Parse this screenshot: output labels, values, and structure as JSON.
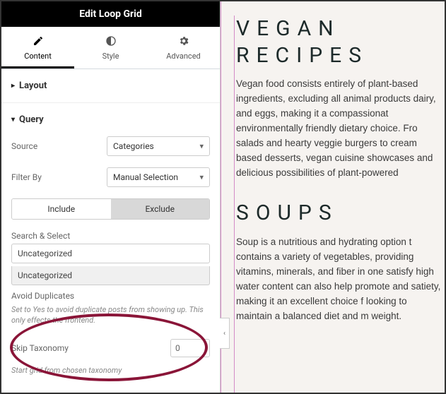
{
  "header": {
    "title": "Edit Loop Grid"
  },
  "tabs": {
    "content": "Content",
    "style": "Style",
    "advanced": "Advanced"
  },
  "sections": {
    "layout": "Layout",
    "query": "Query"
  },
  "query": {
    "source_label": "Source",
    "source_value": "Categories",
    "filter_label": "Filter By",
    "filter_value": "Manual Selection",
    "include_label": "Include",
    "exclude_label": "Exclude",
    "search_label": "Search & Select",
    "search_value": "Uncategorized",
    "dropdown_option": "Uncategorized",
    "avoid_label": "Avoid Duplicates",
    "avoid_help": "Set to Yes to avoid duplicate posts from showing up. This only effects the frontend.",
    "skip_label": "Skip Taxonomy",
    "skip_value": "0",
    "skip_help": "Start grid from chosen taxonomy"
  },
  "preview": {
    "h1a": "VEGAN",
    "h1b": "RECIPES",
    "p1": "Vegan food consists entirely of plant-based ingredients, excluding all animal products dairy, and eggs, making it a compassionat environmentally friendly dietary choice. Fro salads and hearty veggie burgers to cream based desserts, vegan cuisine showcases and delicious possibilities of plant-powered",
    "h2": "SOUPS",
    "p2": "Soup is a nutritious and hydrating option t contains a variety of vegetables, providing vitamins, minerals, and fiber in one satisfy high water content can also help promote and satiety, making it an excellent choice f looking to maintain a balanced diet and m weight."
  },
  "collapse_glyph": "‹"
}
